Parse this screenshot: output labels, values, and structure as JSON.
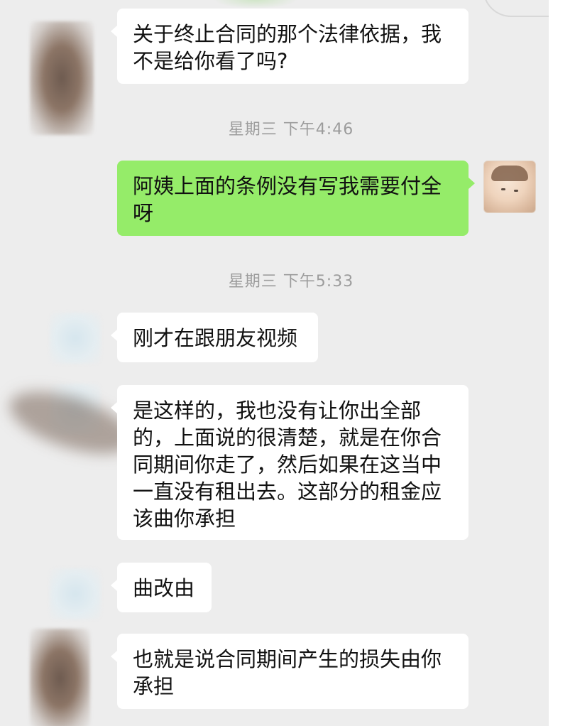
{
  "conversation": {
    "messages": [
      {
        "id": "m1",
        "direction": "incoming",
        "text": "关于终止合同的那个法律依据，我\n不是给你看了吗?"
      },
      {
        "id": "t1",
        "type": "timestamp",
        "text": "星期三 下午4:46"
      },
      {
        "id": "m2",
        "direction": "outgoing",
        "text": "阿姨上面的条例没有写我需要付全\n呀"
      },
      {
        "id": "t2",
        "type": "timestamp",
        "text": "星期三 下午5:33"
      },
      {
        "id": "m3",
        "direction": "incoming",
        "text": "刚才在跟朋友视频"
      },
      {
        "id": "m4",
        "direction": "incoming",
        "text": "是这样的，我也没有让你出全部\n的，上面说的很清楚，就是在你合\n同期间你走了，然后如果在这当中\n一直没有租出去。这部分的租金应\n该曲你承担"
      },
      {
        "id": "m5",
        "direction": "incoming",
        "text": "曲改由"
      },
      {
        "id": "m6",
        "direction": "incoming",
        "text": "也就是说合同期间产生的损失由你\n承担"
      }
    ]
  },
  "colors": {
    "chat_background": "#ededed",
    "incoming_bubble": "#ffffff",
    "outgoing_bubble": "#95ec69",
    "timestamp_text": "#9c9c9c",
    "message_text": "#111111"
  },
  "icons": {
    "contact_avatar": "blurred-contact-avatar-icon",
    "self_avatar": "baby-photo-avatar-icon"
  }
}
